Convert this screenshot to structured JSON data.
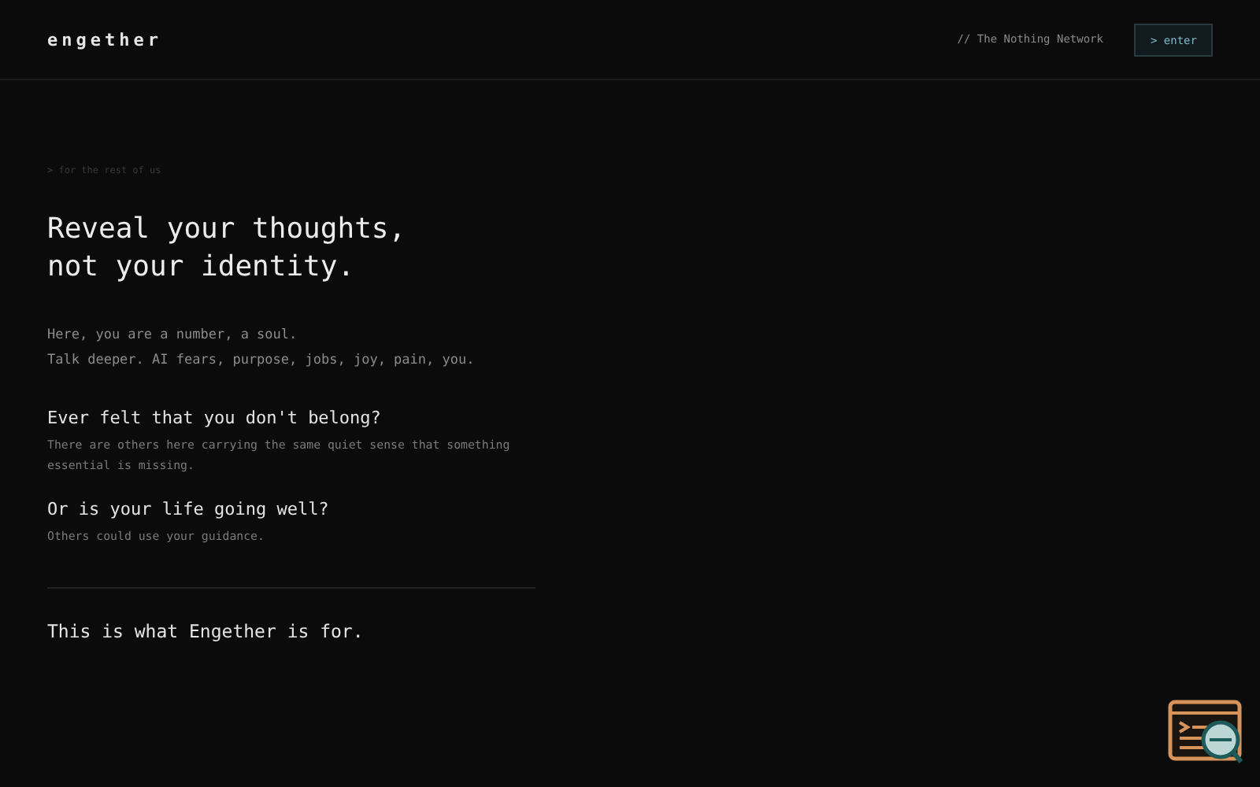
{
  "header": {
    "logo": "engether",
    "tagline": "// The Nothing Network",
    "enter_button": "> enter"
  },
  "hero": {
    "eyebrow": "> for the rest of us",
    "headline": [
      "Reveal your thoughts,",
      "not your identity."
    ],
    "intro": [
      "Here, you are a number, a soul.",
      "Talk deeper. AI fears, purpose, jobs, joy, pain, you."
    ],
    "sections": [
      {
        "question": "Ever felt that you don't belong?",
        "answer": "There are others here carrying the same quiet sense that something essential is missing."
      },
      {
        "question": "Or is your life going well?",
        "answer": "Others could use your guidance."
      }
    ],
    "closing": "This is what Engether is for."
  }
}
